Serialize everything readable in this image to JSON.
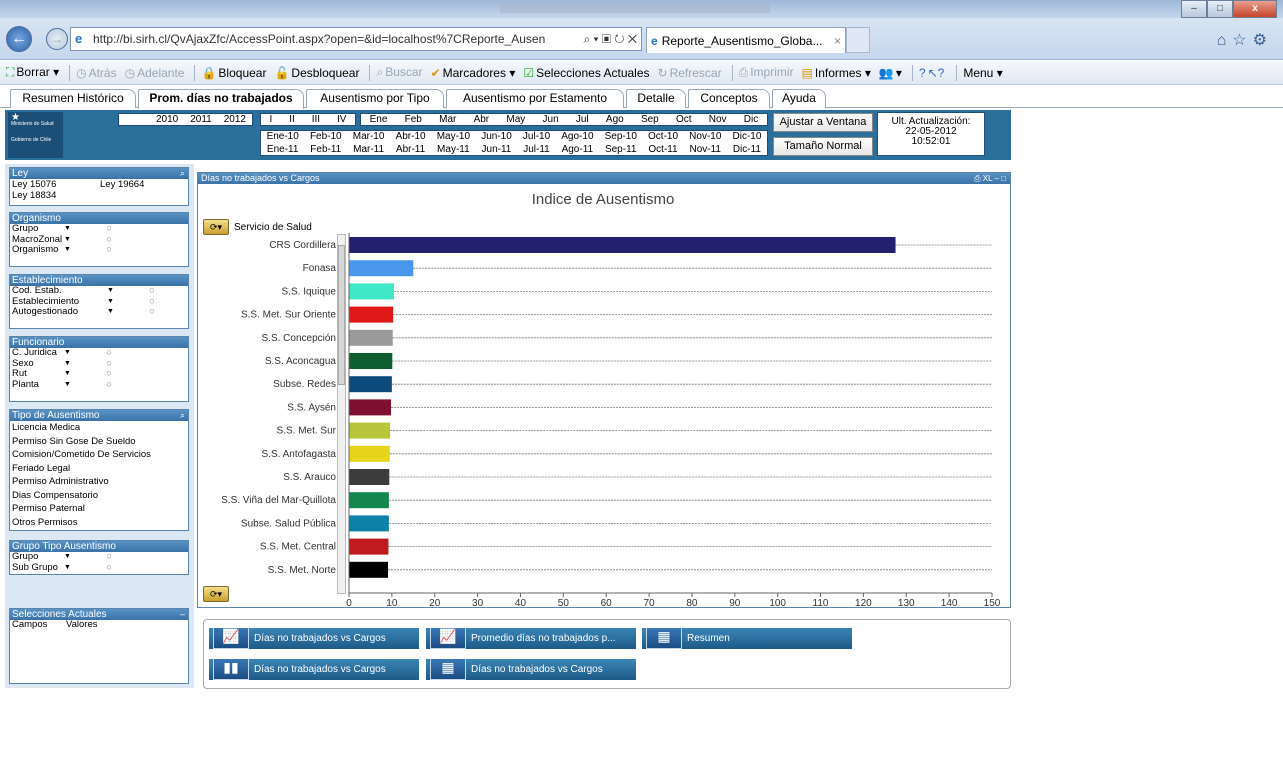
{
  "browser": {
    "url": "http://bi.sirh.cl/QvAjaxZfc/AccessPoint.aspx?open=&id=localhost%7CReporte_Ausen",
    "url_tools": "⌕ ▾ ▣ ↻ ✕",
    "tab_title": "Reporte_Ausentismo_Globa...",
    "tab_close": "×",
    "min": "–",
    "max": "□",
    "close": "x",
    "back": "←",
    "forward": "→",
    "ie_glyph": "e",
    "tools": "⌂☆⚙"
  },
  "commandbar": {
    "borrar": "Borrar",
    "atras": "Atrás",
    "adelante": "Adelante",
    "bloquear": "Bloquear",
    "desbloquear": "Desbloquear",
    "buscar": "Buscar",
    "marcadores": "Marcadores",
    "selecciones": "Selecciones Actuales",
    "refrescar": "Refrescar",
    "imprimir": "Imprimir",
    "informes": "Informes",
    "menu": "Menu"
  },
  "tabs": [
    "Resumen Histórico",
    "Prom. días no trabajados",
    "Ausentismo por Tipo",
    "Ausentismo por Estamento",
    "Detalle",
    "Conceptos",
    "Ayuda"
  ],
  "header": {
    "logo_line1": "Ministerio de Salud",
    "logo_line2": "Gobierno de Chile",
    "years": [
      "2010",
      "2011",
      "2012"
    ],
    "quarters": [
      "I",
      "II",
      "III",
      "IV"
    ],
    "months": [
      "Ene",
      "Feb",
      "Mar",
      "Abr",
      "May",
      "Jun",
      "Jul",
      "Ago",
      "Sep",
      "Oct",
      "Nov",
      "Dic"
    ],
    "monthyear_row1": [
      "Ene-10",
      "Feb-10",
      "Mar-10",
      "Abr-10",
      "May-10",
      "Jun-10",
      "Jul-10",
      "Ago-10",
      "Sep-10",
      "Oct-10",
      "Nov-10",
      "Dic-10"
    ],
    "monthyear_row2": [
      "Ene-11",
      "Feb-11",
      "Mar-11",
      "Abr-11",
      "May-11",
      "Jun-11",
      "Jul-11",
      "Ago-11",
      "Sep-11",
      "Oct-11",
      "Nov-11",
      "Dic-11"
    ],
    "fit_button": "Ajustar a Ventana",
    "normal_button": "Tamaño Normal",
    "update_label": "Ult. Actualización:",
    "update_date": "22-05-2012",
    "update_time": "10:52:01"
  },
  "sidebar": {
    "ley": {
      "title": "Ley",
      "items": [
        "Ley 15076",
        "Ley 19664",
        "Ley 18834"
      ]
    },
    "organismo": {
      "title": "Organismo",
      "rows": [
        "Grupo",
        "MacroZonal",
        "Organismo"
      ]
    },
    "establecimiento": {
      "title": "Establecimiento",
      "rows": [
        "Cod. Estab.",
        "Establecimiento",
        "Autogestionado"
      ]
    },
    "funcionario": {
      "title": "Funcionario",
      "rows": [
        "C. Juridica",
        "Sexo",
        "Rut",
        "Planta"
      ]
    },
    "tipo": {
      "title": "Tipo de Ausentismo",
      "items": [
        "Licencia Medica",
        "Permiso Sin Gose De Sueldo",
        "Comision/Cometido De Servicios",
        "Feriado Legal",
        "Permiso Administrativo",
        "Dias Compensatorio",
        "Permiso Paternal",
        "Otros Permisos"
      ]
    },
    "grupo_tipo": {
      "title": "Grupo Tipo Ausentismo",
      "rows": [
        "Grupo",
        "Sub Grupo"
      ]
    },
    "selecciones": {
      "title": "Selecciones Actuales",
      "col1": "Campos",
      "col2": "Valores"
    }
  },
  "chart_panel": {
    "caption": "Días no trabajados vs Cargos",
    "caption_icons": "⎙ XL – □",
    "dimension_label": "Servicio de Salud"
  },
  "chart_data": {
    "type": "bar",
    "orientation": "horizontal",
    "title": "Indice de Ausentismo",
    "categories": [
      "CRS Cordillera",
      "Fonasa",
      "S.S. Iquique",
      "S.S. Met. Sur Oriente",
      "S.S. Concepción",
      "S.S. Aconcagua",
      "Subse. Redes",
      "S.S. Aysén",
      "S.S. Met. Sur",
      "S.S. Antofagasta",
      "S.S. Arauco",
      "S.S. Viña del Mar-Quillota",
      "Subse. Salud Pública",
      "S.S. Met. Central",
      "S.S. Met. Norte"
    ],
    "values": [
      127.5,
      15,
      10.5,
      10.3,
      10.2,
      10.1,
      10,
      9.8,
      9.6,
      9.5,
      9.4,
      9.3,
      9.3,
      9.2,
      9.1
    ],
    "colors": [
      "#23206f",
      "#4a98ee",
      "#3fe8c6",
      "#e01818",
      "#9a9a9a",
      "#0f5e32",
      "#0d4a7c",
      "#7d1030",
      "#b8c43a",
      "#e6d51a",
      "#3c3c3c",
      "#13874d",
      "#0e81a6",
      "#c01c20",
      "#000000"
    ],
    "xlim": [
      0,
      150
    ],
    "xticks": [
      "0",
      "10",
      "20",
      "30",
      "40",
      "50",
      "60",
      "70",
      "80",
      "90",
      "100",
      "110",
      "120",
      "130",
      "140",
      "150"
    ],
    "grid": "dashed horizontal reference lines"
  },
  "objects": [
    "Días no trabajados vs Cargos",
    "Promedio días no trabajados p...",
    "Resumen",
    "Días no trabajados vs Cargos",
    "Días no trabajados vs Cargos"
  ]
}
